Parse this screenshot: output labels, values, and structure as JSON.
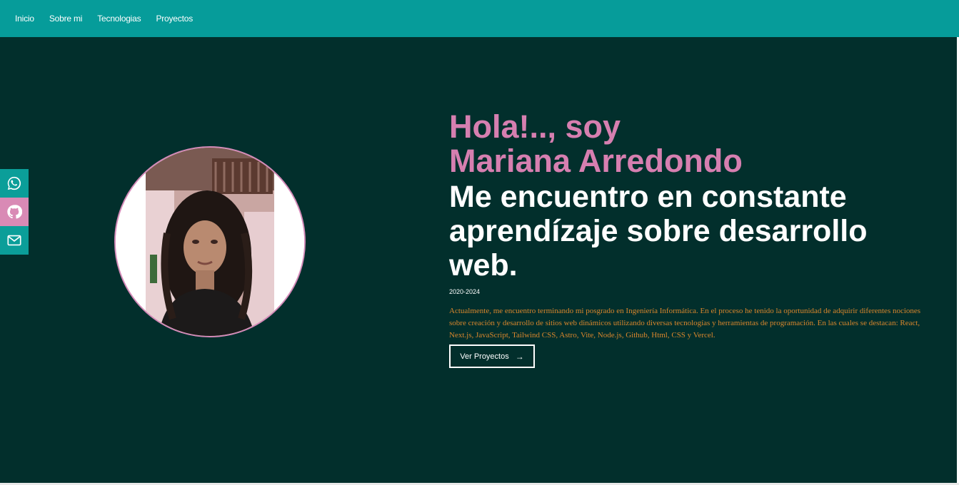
{
  "nav": {
    "items": [
      "Inicio",
      "Sobre mi",
      "Tecnologias",
      "Proyectos"
    ]
  },
  "social": [
    {
      "icon": "whatsapp-icon",
      "color": "#0b9e99"
    },
    {
      "icon": "github-icon",
      "color": "#d98ab5"
    },
    {
      "icon": "mail-icon",
      "color": "#0b9e99"
    }
  ],
  "hero": {
    "hello": "Hola!.., soy",
    "name": "Mariana Arredondo",
    "tagline": "Me encuentro en constante aprendízaje sobre desarrollo web.",
    "years": "2020-2024",
    "description": "Actualmente, me encuentro terminando mi posgrado en Ingeniería Informática. En el proceso he tenido la oportunidad de adquirir diferentes nociones sobre creación y desarrollo de sitios web dinámicos utilizando diversas tecnologías y herramientas de programación. En las cuales se destacan: React, Next.js, JavaScript, Tailwind CSS, Astro, Vite, Node.js, Github, Html, CSS y Vercel.",
    "cta_label": "Ver Proyectos",
    "cta_arrow": "→"
  },
  "colors": {
    "navbar": "#069c9a",
    "background": "#022f2c",
    "accent_pink": "#d67fb0",
    "desc_orange": "#d9862c"
  }
}
